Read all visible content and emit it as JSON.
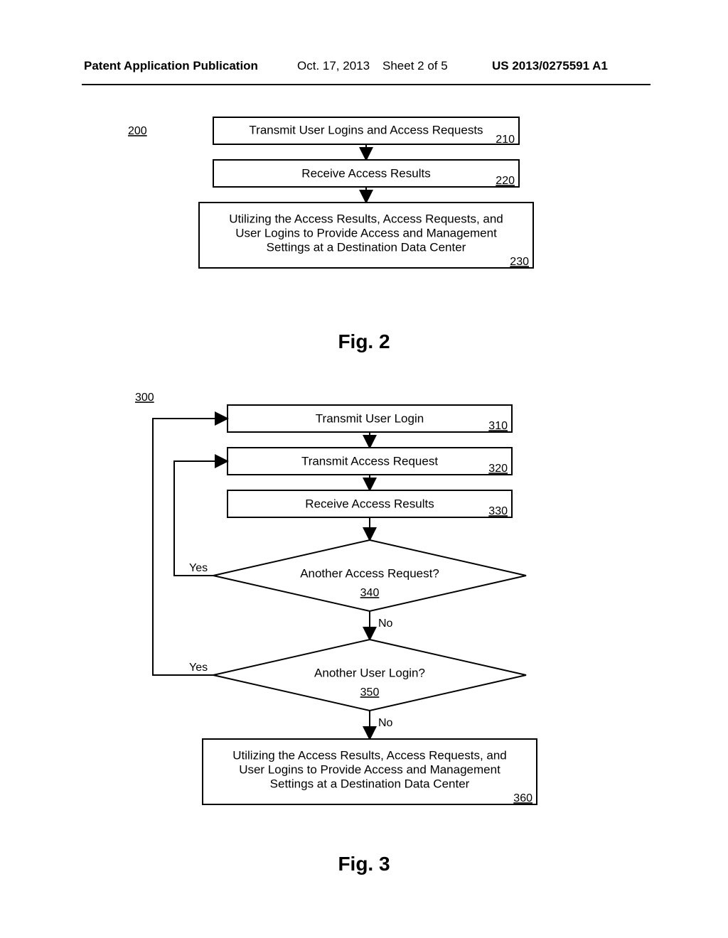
{
  "header": {
    "pub_label": "Patent Application Publication",
    "pub_date": "Oct. 17, 2013",
    "sheet": "Sheet 2 of 5",
    "appnum": "US 2013/0275591 A1"
  },
  "fig2": {
    "label": "Fig. 2",
    "ref": "200",
    "boxes": {
      "b210": {
        "text": "Transmit User Logins and Access Requests",
        "num": "210"
      },
      "b220": {
        "text": "Receive Access Results",
        "num": "220"
      },
      "b230": {
        "l1": "Utilizing the Access Results, Access Requests, and",
        "l2": "User Logins to Provide Access and Management",
        "l3": "Settings at a Destination Data Center",
        "num": "230"
      }
    }
  },
  "fig3": {
    "label": "Fig. 3",
    "ref": "300",
    "boxes": {
      "b310": {
        "text": "Transmit User Login",
        "num": "310"
      },
      "b320": {
        "text": "Transmit Access Request",
        "num": "320"
      },
      "b330": {
        "text": "Receive Access Results",
        "num": "330"
      },
      "b360": {
        "l1": "Utilizing the Access Results, Access Requests, and",
        "l2": "User Logins to Provide Access and Management",
        "l3": "Settings at a Destination Data Center",
        "num": "360"
      }
    },
    "decisions": {
      "d340": {
        "text": "Another Access Request?",
        "num": "340"
      },
      "d350": {
        "text": "Another User Login?",
        "num": "350"
      }
    },
    "edges": {
      "yes": "Yes",
      "no": "No"
    }
  }
}
